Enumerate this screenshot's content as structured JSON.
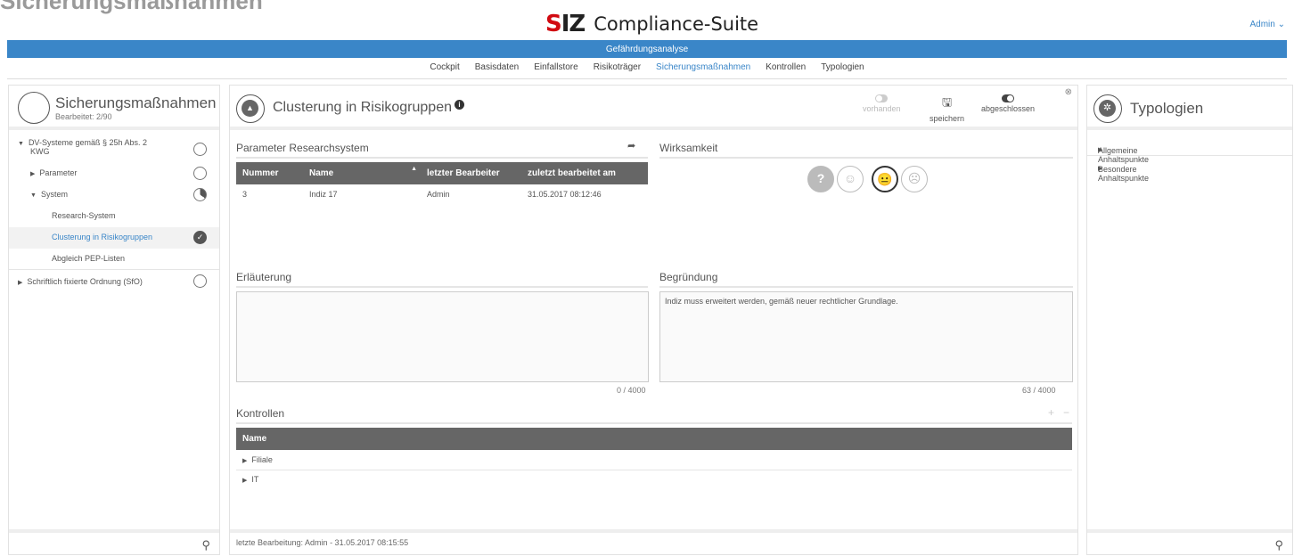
{
  "page_title": "Sicherungsmaßnahmen",
  "brand": {
    "logo_s": "S",
    "logo_iz": "IZ",
    "name": "Compliance-Suite"
  },
  "user_menu": "Admin",
  "module_bar": "Gefährdungsanalyse",
  "nav": [
    {
      "label": "Cockpit"
    },
    {
      "label": "Basisdaten"
    },
    {
      "label": "Einfallstore"
    },
    {
      "label": "Risikoträger"
    },
    {
      "label": "Sicherungsmaßnahmen",
      "active": true
    },
    {
      "label": "Kontrollen"
    },
    {
      "label": "Typologien"
    }
  ],
  "left": {
    "title": "Sicherungsmaßnahmen",
    "subtitle": "Bearbeitet: 2/90",
    "tree": {
      "dv_label": "DV-Systeme gemäß § 25h Abs. 2",
      "dv_label2": "KWG",
      "parameter": "Parameter",
      "system": "System",
      "research": "Research-System",
      "clustering": "Clusterung in Risikogruppen",
      "abgleich": "Abgleich PEP-Listen",
      "sfo": "Schriftlich fixierte Ordnung (SfO)"
    }
  },
  "main": {
    "title": "Clusterung in Risikogruppen",
    "buttons": {
      "vorhanden": "vorhanden",
      "speichern": "speichern",
      "abgeschlossen": "abgeschlossen"
    },
    "parameter_title": "Parameter Researchsystem",
    "param_table": {
      "headers": {
        "nummer": "Nummer",
        "name": "Name",
        "bearbeiter": "letzter Bearbeiter",
        "datum": "zuletzt bearbeitet am"
      },
      "row": {
        "nummer": "3",
        "name": "Indiz 17",
        "bearbeiter": "Admin",
        "datum": "31.05.2017 08:12:46"
      }
    },
    "wirksamkeit_title": "Wirksamkeit",
    "erlaeuterung_title": "Erläuterung",
    "erlaeuterung_text": "",
    "erlaeuterung_counter": "0 / 4000",
    "begruendung_title": "Begründung",
    "begruendung_text": "Indiz muss erweitert werden, gemäß neuer rechtlicher Grundlage.",
    "begruendung_counter": "63 / 4000",
    "kontrollen_title": "Kontrollen",
    "kontrollen_header": "Name",
    "kontrollen_rows": {
      "r1": "Filiale",
      "r2": "IT"
    },
    "footer": "letzte Bearbeitung: Admin - 31.05.2017 08:15:55"
  },
  "right": {
    "title": "Typologien",
    "items": {
      "i1": "Allgemeine Anhaltspunkte",
      "i2": "Besondere Anhaltspunkte"
    }
  }
}
